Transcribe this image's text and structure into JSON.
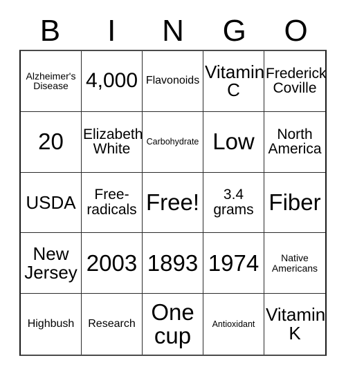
{
  "card": {
    "title": "BINGO",
    "columns": [
      "B",
      "I",
      "N",
      "G",
      "O"
    ],
    "free_space_label": "Free!",
    "grid_rows": [
      {
        "cells": [
          {
            "text": "Alzheimer's Disease",
            "size": "xs",
            "marked": false
          },
          {
            "text": "4,000",
            "size": "xl",
            "marked": false
          },
          {
            "text": "Flavonoids",
            "size": "sm",
            "marked": false
          },
          {
            "text": "Vitamin C",
            "size": "lg",
            "marked": false
          },
          {
            "text": "Frederick Coville",
            "size": "md",
            "marked": false
          }
        ]
      },
      {
        "cells": [
          {
            "text": "20",
            "size": "xxl",
            "marked": false
          },
          {
            "text": "Elizabeth White",
            "size": "md",
            "marked": false
          },
          {
            "text": "Carbohydrate",
            "size": "xxs",
            "marked": false
          },
          {
            "text": "Low",
            "size": "xxl",
            "marked": false
          },
          {
            "text": "North America",
            "size": "md",
            "marked": false
          }
        ]
      },
      {
        "cells": [
          {
            "text": "USDA",
            "size": "lg",
            "marked": false
          },
          {
            "text": "Free-radicals",
            "size": "md",
            "marked": false
          },
          {
            "text": "Free!",
            "size": "xxl",
            "marked": false,
            "free": true
          },
          {
            "text": "3.4 grams",
            "size": "md",
            "marked": false
          },
          {
            "text": "Fiber",
            "size": "xxl",
            "marked": false
          }
        ]
      },
      {
        "cells": [
          {
            "text": "New Jersey",
            "size": "lg",
            "marked": false
          },
          {
            "text": "2003",
            "size": "xxl",
            "marked": false
          },
          {
            "text": "1893",
            "size": "xxl",
            "marked": false
          },
          {
            "text": "1974",
            "size": "xxl",
            "marked": false
          },
          {
            "text": "Native Americans",
            "size": "xs",
            "marked": false
          }
        ]
      },
      {
        "cells": [
          {
            "text": "Highbush",
            "size": "sm",
            "marked": false
          },
          {
            "text": "Research",
            "size": "sm",
            "marked": false
          },
          {
            "text": "One cup",
            "size": "xxl",
            "marked": false
          },
          {
            "text": "Antioxidant",
            "size": "xxs",
            "marked": false
          },
          {
            "text": "Vitamin K",
            "size": "lg",
            "marked": false
          }
        ]
      }
    ]
  },
  "colors": {
    "background": "#ffffff",
    "text": "#000000",
    "grid_line": "#2b2b2b",
    "outer_border": "#1a1a1a"
  }
}
